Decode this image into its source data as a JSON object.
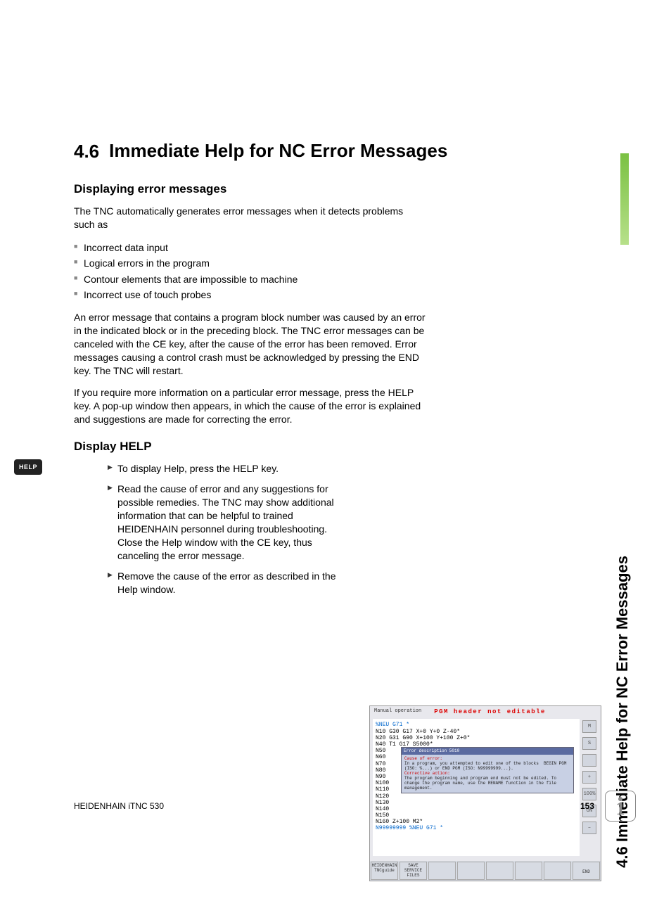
{
  "section": {
    "number": "4.6",
    "title": "Immediate Help for NC Error Messages"
  },
  "h2_1": "Displaying error messages",
  "p1": "The TNC automatically generates error messages when it detects problems such as",
  "bullets1": [
    "Incorrect data input",
    "Logical errors in the program",
    "Contour elements that are impossible to machine",
    "Incorrect use of touch probes"
  ],
  "p2": "An error message that contains a program block number was caused by an error in the indicated block or in the preceding block. The TNC error messages can be canceled with the CE key, after the cause of the error has been removed. Error messages causing a control crash must be acknowledged by pressing the END key. The TNC will restart.",
  "p3": "If you require more information on a particular error message, press the HELP key. A pop-up window then appears, in which the cause of the error is explained and suggestions are made for correcting the error.",
  "h2_2": "Display HELP",
  "help_key": "HELP",
  "bullets2": [
    "To display Help, press the HELP key.",
    "Read the cause of error and any suggestions for possible remedies. The TNC may show additional information that can be helpful to trained HEIDENHAIN personnel during troubleshooting. Close the Help window with the CE key, thus canceling the error message.",
    "Remove the cause of the error as described in the Help window."
  ],
  "screenshot": {
    "mode": "Manual operation",
    "error": "PGM header not editable",
    "code": {
      "l0": "%NEU G71 *",
      "l1": "N10 G30 G17 X+0 Y+0 Z-40*",
      "l2": "N20 G31 G90 X+100 Y+100 Z+0*",
      "l3": "N40 T1 G17 S5000*",
      "l4": "N50",
      "l5": "N60",
      "l6": "N70",
      "l7": "N80",
      "l8": "N90",
      "l9": "N100",
      "l10": "N110",
      "l11": "N120",
      "l12": "N130",
      "l13": "N140",
      "l14": "N150",
      "l15": "N160 Z+100 M2*",
      "l16": "N99999999 %NEU G71 *"
    },
    "popup": {
      "title": "Error description 5010",
      "cause_label": "Cause of error:",
      "cause": "In a program, you attempted to edit one of the blocks  BEGIN PGM (ISO: %...) or END PGM (ISO: N99999999...).",
      "action_label": "Corrective action:",
      "action": "The program beginning and program end must not be edited. To change the program name, use the RENAME function in the file management."
    },
    "softkeys": {
      "k1a": "HEIDENHAIN",
      "k1b": "TNCguide",
      "k2a": "SAVE",
      "k2b": "SERVICE",
      "k2c": "FILES",
      "k8": "END"
    },
    "side": {
      "s1": "M",
      "s2": "S",
      "s3": "+",
      "s4": "100%",
      "s5": "ON",
      "s6": "–"
    }
  },
  "sidetab": "4.6 Immediate Help for NC Error Messages",
  "footer": {
    "left": "HEIDENHAIN iTNC 530",
    "page": "153"
  }
}
